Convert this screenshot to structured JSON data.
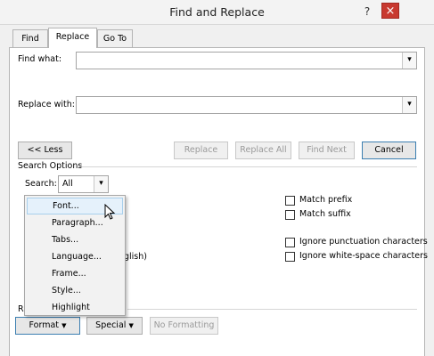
{
  "window": {
    "title": "Find and Replace",
    "help": "?",
    "close": "×"
  },
  "tabs": [
    {
      "label": "Find"
    },
    {
      "label": "Replace"
    },
    {
      "label": "Go To"
    }
  ],
  "find": {
    "label": "Find what:",
    "value": ""
  },
  "replace": {
    "label": "Replace with:",
    "value": ""
  },
  "buttons": {
    "less": "<< Less",
    "replace": "Replace",
    "replace_all": "Replace All",
    "find_next": "Find Next",
    "cancel": "Cancel"
  },
  "search_options": {
    "heading": "Search Options",
    "search_label": "Search:",
    "search_value": "All"
  },
  "options_right": {
    "match_prefix": "Match prefix",
    "match_suffix": "Match suffix",
    "ignore_punct": "Ignore punctuation characters",
    "ignore_ws": "Ignore white-space characters"
  },
  "partial": {
    "lang_tail": "glish)",
    "replace_heading": "R"
  },
  "format_menu": {
    "items": [
      "Font...",
      "Paragraph...",
      "Tabs...",
      "Language...",
      "Frame...",
      "Style...",
      "Highlight"
    ]
  },
  "bottom": {
    "format": "Format",
    "special": "Special",
    "no_formatting": "No Formatting"
  }
}
